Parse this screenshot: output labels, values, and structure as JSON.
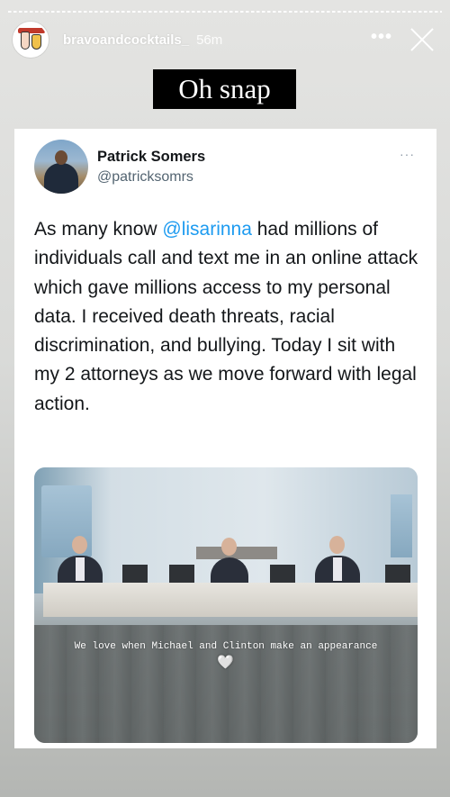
{
  "story": {
    "username": "bravoandcocktails_",
    "time": "56m",
    "more_icon": "ellipsis-icon",
    "close_icon": "close-icon"
  },
  "sticker": {
    "text": "Oh snap"
  },
  "tweet": {
    "name": "Patrick Somers",
    "handle": "@patricksomrs",
    "more": "···",
    "text_before": "As many know ",
    "mention": "@lisarinna",
    "text_after": " had millions of individuals call and text me in an online attack which gave millions access to my personal data. I received death threats, racial discrimination, and bullying. Today I sit with my 2 attorneys as we move forward with legal action."
  },
  "video": {
    "caption": "We love when Michael and Clinton make an appearance",
    "caption_emoji": "🤍"
  },
  "colors": {
    "mention": "#1d9bf0",
    "sticker_bg": "#000000"
  }
}
